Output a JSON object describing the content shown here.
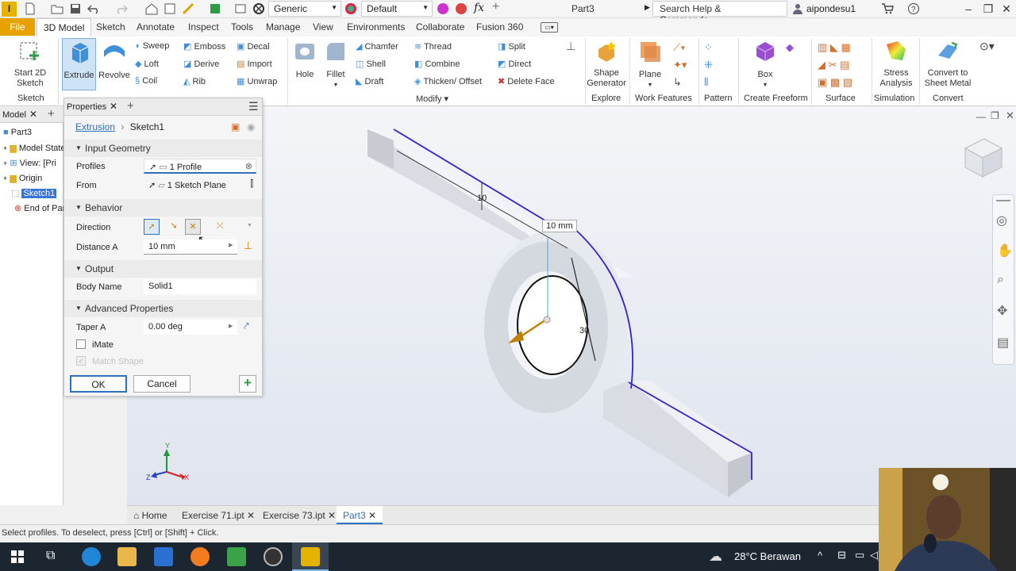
{
  "app": {
    "logo": "I",
    "document_title": "Part3",
    "appearance_dropdown": "Generic",
    "style_dropdown": "Default",
    "search_placeholder": "Search Help & Commands...",
    "user": "aipondesu1"
  },
  "ribbon_tabs": [
    "File",
    "3D Model",
    "Sketch",
    "Annotate",
    "Inspect",
    "Tools",
    "Manage",
    "View",
    "Environments",
    "Collaborate",
    "Fusion 360"
  ],
  "ribbon": {
    "sketch_group": {
      "start_sketch": "Start 2D Sketch",
      "label": "Sketch"
    },
    "create": {
      "extrude": "Extrude",
      "revolve": "Revolve",
      "small": [
        "Sweep",
        "Loft",
        "Coil",
        "Emboss",
        "Derive",
        "Rib",
        "Decal",
        "Import",
        "Unwrap"
      ]
    },
    "modify": {
      "hole": "Hole",
      "fillet": "Fillet",
      "small": [
        "Chamfer",
        "Shell",
        "Draft",
        "Thread",
        "Combine",
        "Thicken/ Offset",
        "Split",
        "Direct",
        "Delete Face"
      ],
      "label": "Modify"
    },
    "explore": {
      "shape_generator": "Shape Generator",
      "label": "Explore"
    },
    "work_features": {
      "plane": "Plane",
      "label": "Work Features"
    },
    "pattern": {
      "label": "Pattern"
    },
    "freeform": {
      "box": "Box",
      "label": "Create Freeform"
    },
    "surface": {
      "label": "Surface"
    },
    "simulation": {
      "stress": "Stress Analysis",
      "label": "Simulation"
    },
    "convert": {
      "sheet_metal": "Convert to Sheet Metal",
      "label": "Convert"
    }
  },
  "browser": {
    "tab": "Model",
    "items": [
      "Part3",
      "Model State",
      "View: [Pri",
      "Origin",
      "Sketch1",
      "End of Par"
    ]
  },
  "properties": {
    "tab": "Properties",
    "breadcrumb": [
      "Extrusion",
      "Sketch1"
    ],
    "input_geometry": {
      "header": "Input Geometry",
      "profiles_label": "Profiles",
      "profiles_value": "1 Profile",
      "from_label": "From",
      "from_value": "1 Sketch Plane"
    },
    "behavior": {
      "header": "Behavior",
      "direction_label": "Direction",
      "distance_label": "Distance A",
      "distance_value": "10 mm"
    },
    "output": {
      "header": "Output",
      "body_name_label": "Body Name",
      "body_name_value": "Solid1"
    },
    "advanced": {
      "header": "Advanced Properties",
      "taper_label": "Taper A",
      "taper_value": "0.00 deg",
      "imate": "iMate",
      "match_shape": "Match Shape"
    },
    "ok": "OK",
    "cancel": "Cancel"
  },
  "viewport": {
    "dim_label": "10 mm",
    "dim_10": "10",
    "dim_30": "30",
    "triad": {
      "x": "X",
      "y": "Y",
      "z": "Z"
    }
  },
  "doc_tabs": [
    "Home",
    "Exercise 71.ipt",
    "Exercise 73.ipt",
    "Part3"
  ],
  "status": "Select profiles. To deselect, press [Ctrl] or [Shift] + Click.",
  "taskbar": {
    "weather": "28°C  Berawan"
  },
  "colors": {
    "accent": "#e8a200",
    "selection_blue": "#2f6fc0",
    "edge_purple": "#3a1fd1"
  }
}
